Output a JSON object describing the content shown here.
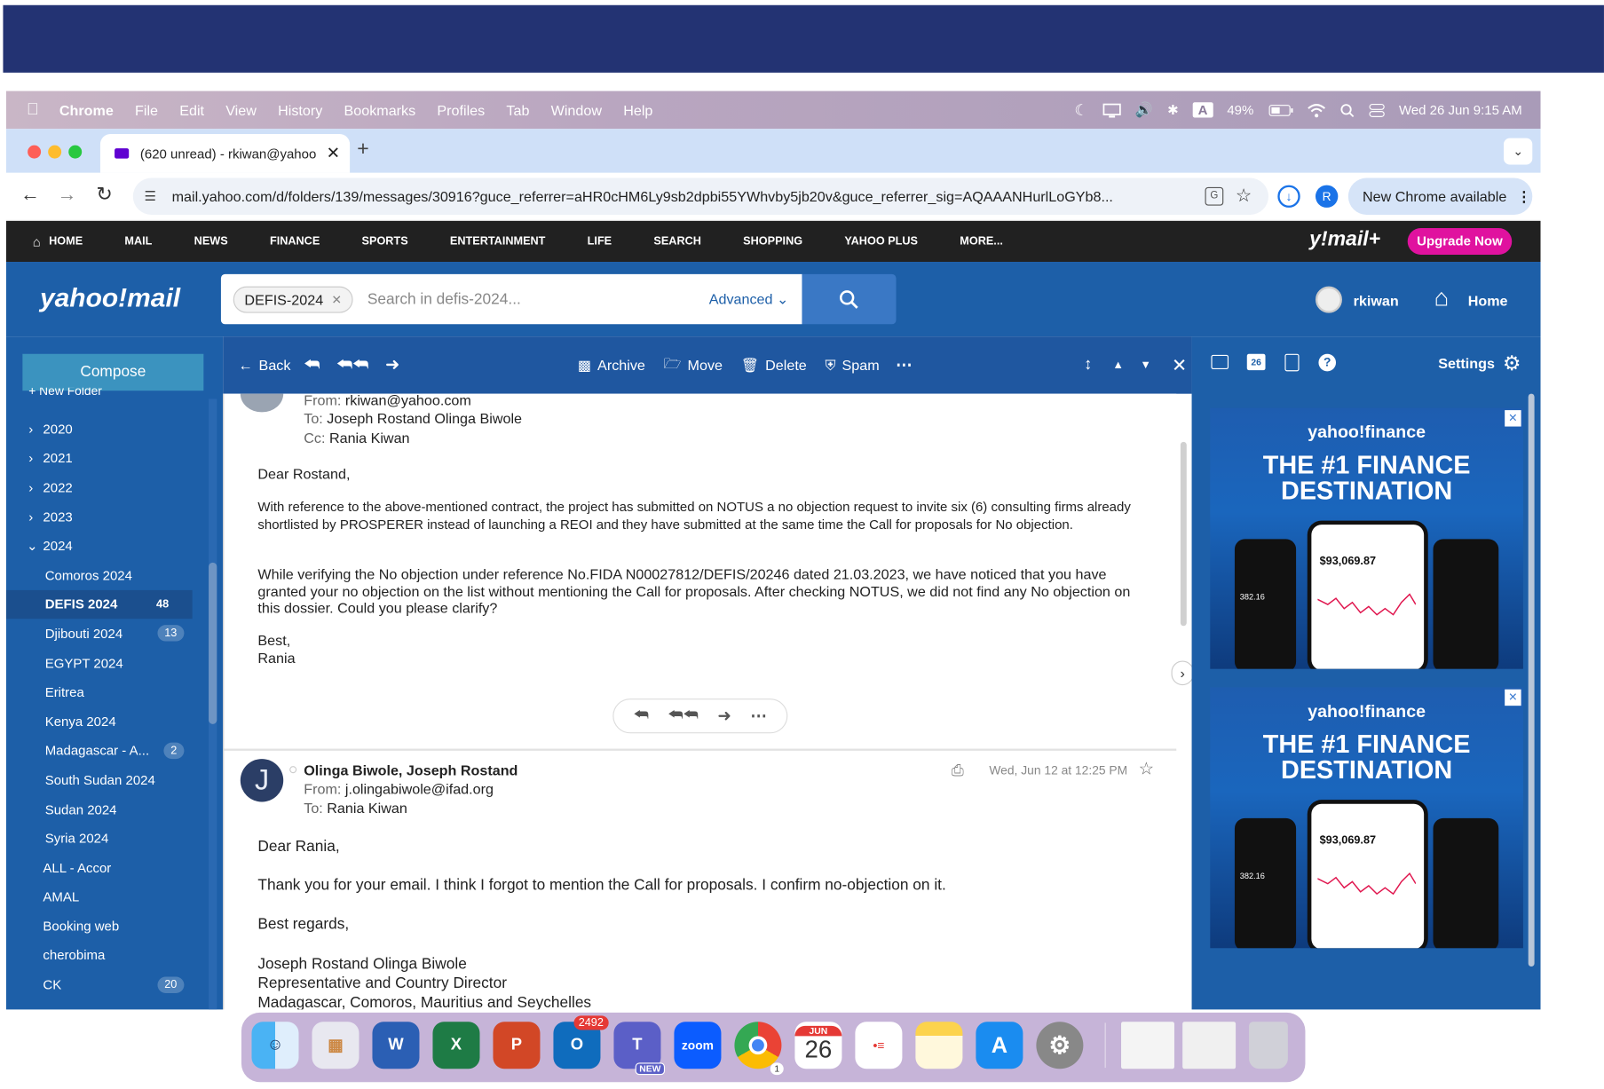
{
  "mac": {
    "menu": [
      "Chrome",
      "File",
      "Edit",
      "View",
      "History",
      "Bookmarks",
      "Profiles",
      "Tab",
      "Window",
      "Help"
    ],
    "battery": "49%",
    "input_source": "A",
    "datetime": "Wed 26 Jun  9:15 AM"
  },
  "browser": {
    "tab_title": "(620 unread) - rkiwan@yahoo",
    "url": "mail.yahoo.com/d/folders/139/messages/30916?guce_referrer=aHR0cHM6Ly9sb2dpbi55YWhvby5jb20v&guce_referrer_sig=AQAAANHurlLoGYb8...",
    "profile_initial": "R",
    "update_label": "New Chrome available"
  },
  "yahoo_nav": {
    "items": [
      "HOME",
      "MAIL",
      "NEWS",
      "FINANCE",
      "SPORTS",
      "ENTERTAINMENT",
      "LIFE",
      "SEARCH",
      "SHOPPING",
      "YAHOO PLUS",
      "MORE..."
    ],
    "logo": "y!mail+",
    "upgrade": "Upgrade Now"
  },
  "header": {
    "logo": "yahoo!mail",
    "search_chip": "DEFIS-2024",
    "search_placeholder": "Search in defis-2024...",
    "advanced": "Advanced",
    "user": "rkiwan",
    "home": "Home"
  },
  "sidebar": {
    "compose": "Compose",
    "new_folder": "+ New Folder",
    "years": [
      "2020",
      "2021",
      "2022",
      "2023",
      "2024"
    ],
    "folders": [
      {
        "label": "Comoros 2024",
        "count": ""
      },
      {
        "label": "DEFIS 2024",
        "count": "48"
      },
      {
        "label": "Djibouti 2024",
        "count": "13"
      },
      {
        "label": "EGYPT 2024",
        "count": ""
      },
      {
        "label": "Eritrea",
        "count": ""
      },
      {
        "label": "Kenya 2024",
        "count": ""
      },
      {
        "label": "Madagascar - A...",
        "count": "2"
      },
      {
        "label": "South Sudan 2024",
        "count": ""
      },
      {
        "label": "Sudan 2024",
        "count": ""
      },
      {
        "label": "Syria 2024",
        "count": ""
      }
    ],
    "other": [
      {
        "label": "ALL - Accor",
        "count": ""
      },
      {
        "label": "AMAL",
        "count": ""
      },
      {
        "label": "Booking web",
        "count": ""
      },
      {
        "label": "cherobima",
        "count": ""
      },
      {
        "label": "CK",
        "count": "20"
      }
    ]
  },
  "toolbar": {
    "back": "Back",
    "archive": "Archive",
    "move": "Move",
    "delete": "Delete",
    "spam": "Spam",
    "settings": "Settings"
  },
  "message1": {
    "from_label": "From:",
    "from": "rkiwan@yahoo.com",
    "to_label": "To:",
    "to": "Joseph Rostand Olinga Biwole",
    "cc_label": "Cc:",
    "cc": "Rania Kiwan",
    "greeting": "Dear Rostand,",
    "p1": "With reference to the above-mentioned contract, the project has submitted on NOTUS a no objection request to invite six (6) consulting firms already shortlisted by PROSPERER instead of launching a REOI and they have submitted at the same time the Call for proposals for No objection.",
    "p2": "While verifying the No objection under reference No.FIDA N00027812/DEFIS/20246 dated 21.03.2023, we have noticed that you have granted your no objection on the list without mentioning the Call for proposals. After checking NOTUS, we did not find any No objection on this dossier. Could you please clarify?",
    "sign1": "Best,",
    "sign2": "Rania"
  },
  "message2": {
    "sender": "Olinga Biwole, Joseph Rostand",
    "from_label": "From:",
    "from": "j.olingabiwole@ifad.org",
    "to_label": "To:",
    "to": "Rania Kiwan",
    "date": "Wed, Jun 12 at 12:25 PM",
    "avatar": "J",
    "greeting": "Dear Rania,",
    "p1": "Thank you for your email. I think I forgot to mention the Call for proposals. I confirm no-objection on it.",
    "sign": "Best regards,",
    "name": "Joseph Rostand Olinga Biwole",
    "title": "Representative and Country Director",
    "region": "Madagascar, Comoros, Mauritius and Seychelles"
  },
  "ads": [
    {
      "brand": "yahoo!finance",
      "headline1": "THE #1 FINANCE",
      "headline2": "DESTINATION",
      "value": "$93,069.87",
      "side": "382.16"
    },
    {
      "brand": "yahoo!finance",
      "headline1": "THE #1 FINANCE",
      "headline2": "DESTINATION",
      "value": "$93,069.87",
      "side": "382.16"
    }
  ],
  "dock": {
    "outlook_badge": "2492",
    "teams_badge": "NEW",
    "zoom": "zoom",
    "cal_month": "JUN",
    "cal_day": "26",
    "chrome_badge": "1"
  }
}
